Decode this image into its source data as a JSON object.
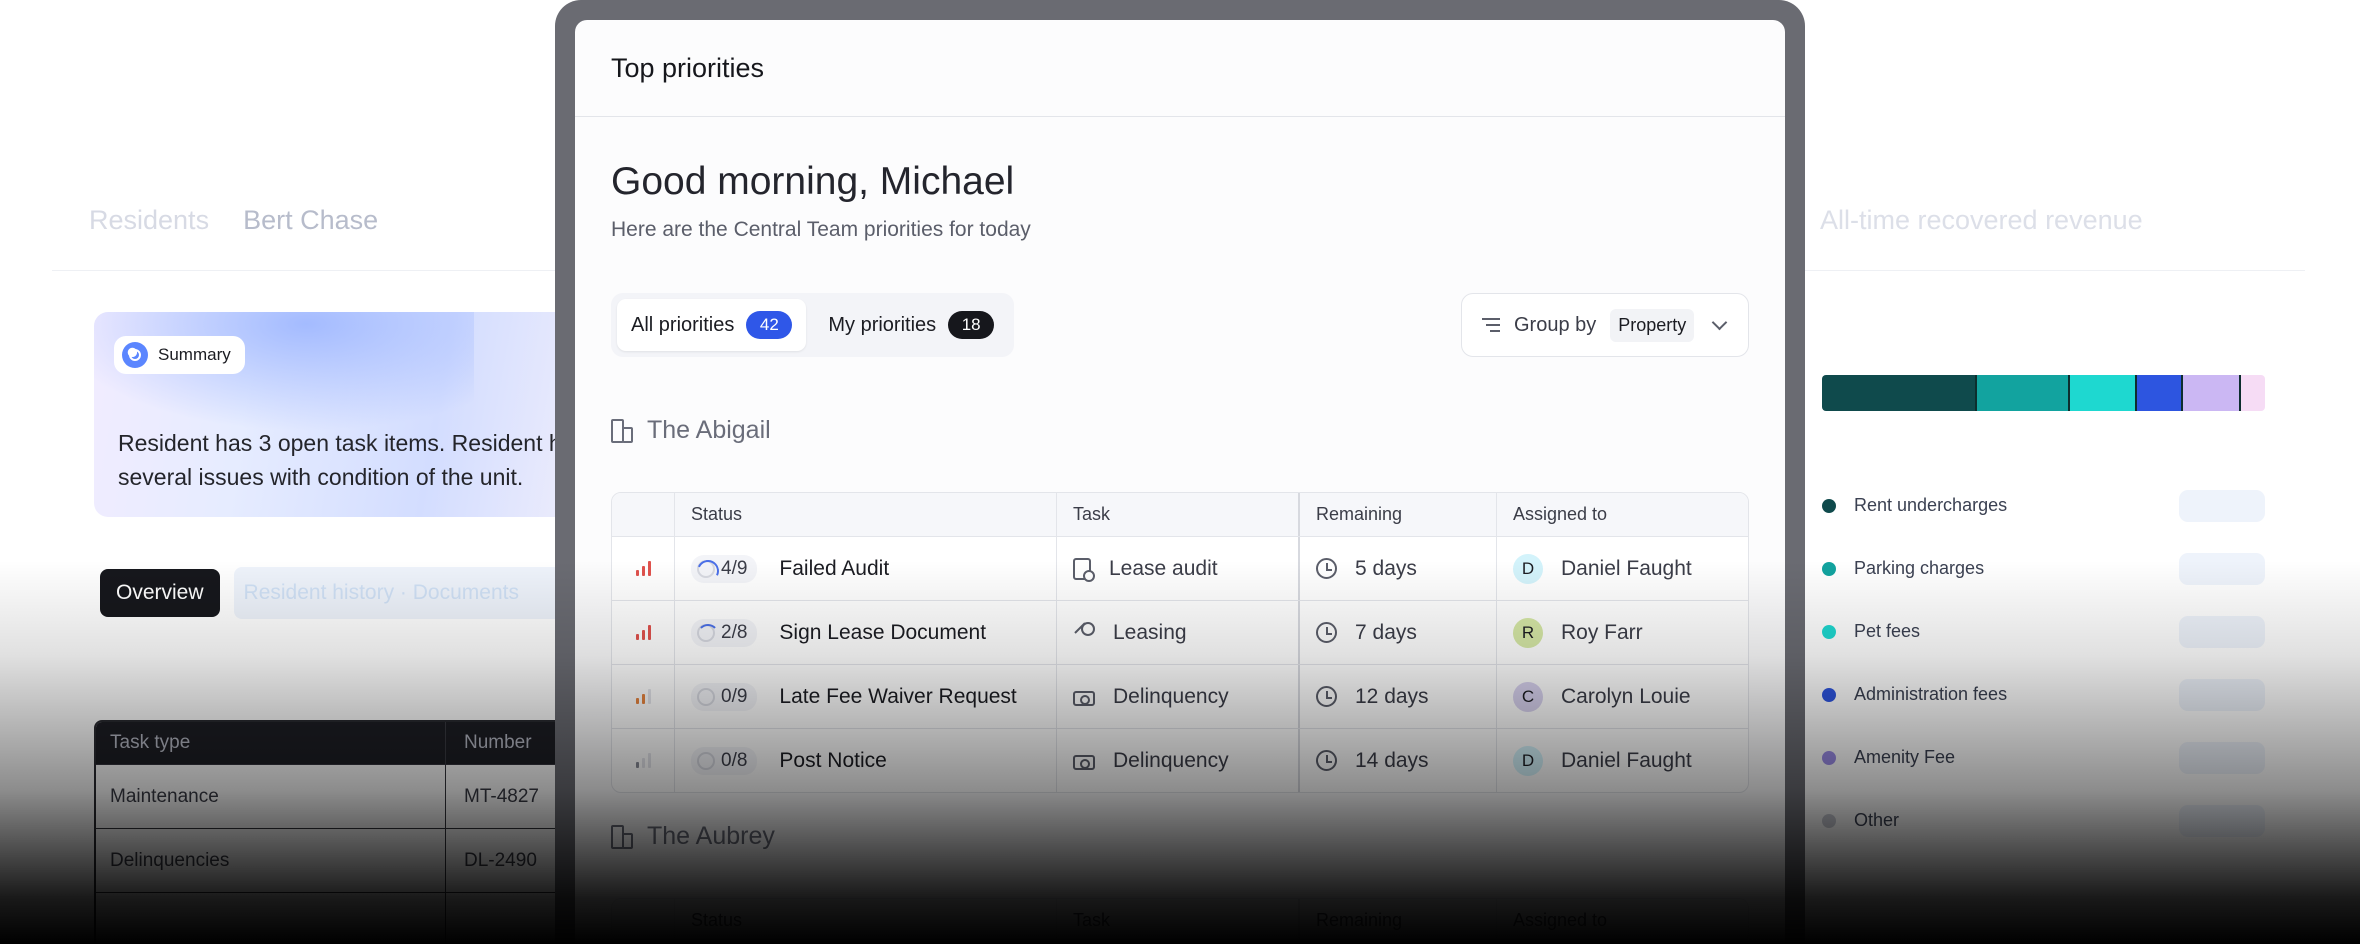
{
  "background_left": {
    "breadcrumb": [
      "Residents",
      "Bert Chase"
    ],
    "summary": {
      "label": "Summary",
      "text": "Resident has 3 open task items. Resident has reported several issues with condition of the unit."
    },
    "overview_label": "Overview",
    "overview_faded": "Resident history · Documents",
    "table": {
      "headers": [
        "Task type",
        "Number"
      ],
      "rows": [
        [
          "Maintenance",
          "MT-4827"
        ],
        [
          "Delinquencies",
          "DL-2490"
        ]
      ]
    }
  },
  "background_right": {
    "title": "All-time recovered revenue",
    "bar_colors": [
      "#0f4a4c",
      "#12a39f",
      "#1ed8d0",
      "#2d55e0",
      "#cbb7f3",
      "#f6dcf5"
    ],
    "bar_shares": [
      0.35,
      0.21,
      0.15,
      0.105,
      0.13,
      0.055
    ],
    "legend": [
      {
        "label": "Rent undercharges",
        "color": "#0f4a4c"
      },
      {
        "label": "Parking charges",
        "color": "#12a39f"
      },
      {
        "label": "Pet fees",
        "color": "#1ed8d0"
      },
      {
        "label": "Administration fees",
        "color": "#2d55e0"
      },
      {
        "label": "Amenity Fee",
        "color": "#9b8ce8"
      },
      {
        "label": "Other",
        "color": "#c9cbd4"
      }
    ]
  },
  "window": {
    "title": "Top priorities",
    "greeting": "Good morning, Michael",
    "subtitle": "Here are the Central Team priorities for today",
    "tabs": [
      {
        "label": "All priorities",
        "count": "42"
      },
      {
        "label": "My priorities",
        "count": "18"
      }
    ],
    "group_by": {
      "label": "Group by",
      "value": "Property"
    },
    "columns": [
      "Status",
      "Task",
      "Remaining",
      "Assigned to"
    ],
    "sections": [
      {
        "title": "The Abigail",
        "rows": [
          {
            "priority": "high",
            "progress": "4/9",
            "name": "Failed Audit",
            "task": "Lease audit",
            "task_icon": "audit-icon",
            "remaining": "5 days",
            "assignee": "Daniel Faught",
            "initial": "D",
            "avatar_color": "#d3f3fb"
          },
          {
            "priority": "high",
            "progress": "2/8",
            "name": "Sign Lease Document",
            "task": "Leasing",
            "task_icon": "key-icon",
            "remaining": "7 days",
            "assignee": "Roy Farr",
            "initial": "R",
            "avatar_color": "#d6e8a6"
          },
          {
            "priority": "medium",
            "progress": "0/9",
            "name": "Late Fee Waiver Request",
            "task": "Delinquency",
            "task_icon": "cash-icon",
            "remaining": "12 days",
            "assignee": "Carolyn Louie",
            "initial": "C",
            "avatar_color": "#d8d2ef"
          },
          {
            "priority": "low",
            "progress": "0/8",
            "name": "Post Notice",
            "task": "Delinquency",
            "task_icon": "cash-icon",
            "remaining": "14 days",
            "assignee": "Daniel Faught",
            "initial": "D",
            "avatar_color": "#d3f3fb"
          }
        ]
      },
      {
        "title": "The Aubrey",
        "rows": []
      }
    ]
  },
  "colors": {
    "priority_high": "#e0524d",
    "priority_medium": "#e6843f",
    "priority_low": "#8a8d98",
    "accent": "#2f57e8"
  }
}
